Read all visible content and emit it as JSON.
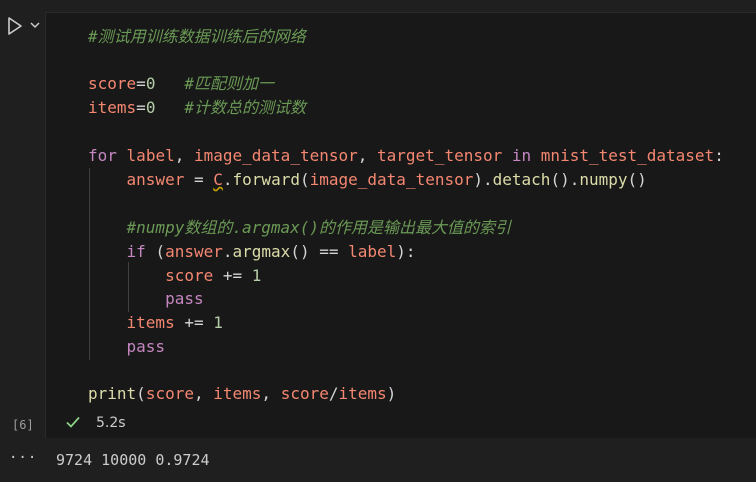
{
  "cell": {
    "execution_count": "[6]",
    "duration": "5.2s",
    "code_lines": [
      "#测试用训练数据训练后的网络",
      "",
      "score=0   #匹配则加一",
      "items=0   #计数总的测试数",
      "",
      "for label, image_data_tensor, target_tensor in mnist_test_dataset:",
      "    answer = C.forward(image_data_tensor).detach().numpy()",
      "",
      "    #numpy数组的.argmax()的作用是输出最大值的索引",
      "    if (answer.argmax() == label):",
      "        score += 1",
      "        pass",
      "    items += 1",
      "    pass",
      "",
      "print(score, items, score/items)"
    ]
  },
  "output": {
    "text": "9724 10000 0.9724",
    "menu_icon": "ellipsis-icon"
  },
  "icons": {
    "run": "play-icon",
    "run_options": "chevron-down-icon",
    "status": "check-icon"
  },
  "colors": {
    "background": "#1f1f1f",
    "cell_background": "#181818",
    "comment": "#6a9955",
    "variable": "#f48771",
    "keyword": "#c586c0",
    "function": "#dcdcaa",
    "number": "#b5cea8",
    "success": "#89d185"
  }
}
